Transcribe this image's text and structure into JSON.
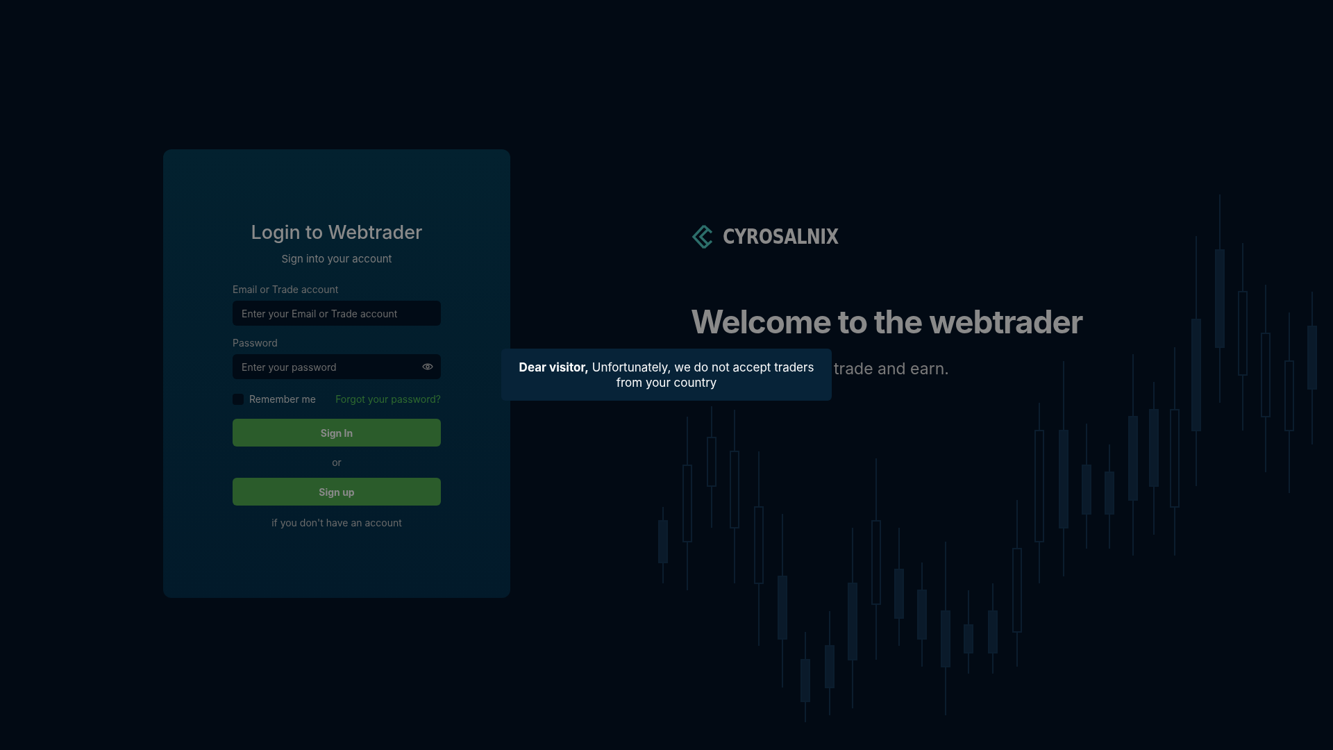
{
  "login": {
    "title": "Login to Webtrader",
    "subtitle": "Sign into your account",
    "fields": [
      {
        "label": "Email or Trade account",
        "placeholder": "Enter your Email or Trade account",
        "kind": "text"
      },
      {
        "label": "Password",
        "placeholder": "Enter your password",
        "kind": "password"
      }
    ],
    "remember_me": {
      "label": "Remember me",
      "checked": false
    },
    "forgot_link": "Forgot your password?",
    "sign_in_button": "Sign In",
    "separator": "or",
    "sign_up_button": "Sign up",
    "sign_up_hint": "if you don't have an account"
  },
  "welcome": {
    "brand": "CYROSALNIX",
    "heading": "Welcome to the webtrader",
    "subtitle": "trade and earn."
  },
  "toast": {
    "message": "**Dear visitor,** Unfortunately, we do not accept traders from your country"
  }
}
